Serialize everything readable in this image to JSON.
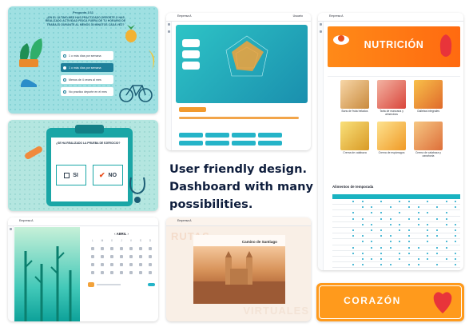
{
  "tagline": [
    "User friendly design.",
    "Dashboard with many",
    "possibilities."
  ],
  "quiz": {
    "number": "Pregunta 1/11",
    "question": "¿En el último mes has practicado deporte o has realizado actividad física fuera de tu horario de trabajo durante al menos 30 minutos cada vez?",
    "options": [
      "1 o más días por semana",
      "1 o más días por semana",
      "Menos de 4 veces al mes",
      "No practico deporte en el mes"
    ]
  },
  "clipboard": {
    "question": "¿Se ha realizado la prueba de ejercicio?",
    "yes": "SI",
    "no": "NO"
  },
  "calendar": {
    "month": "ABRIL",
    "weekdays": [
      "L",
      "M",
      "X",
      "J",
      "V",
      "S",
      "D"
    ]
  },
  "dashboard": {
    "title": "Empresa A",
    "user": "Usuario"
  },
  "nutrition": {
    "title": "NUTRICIÓN",
    "dishes": [
      "Buns de fruta helados",
      "Tarta de manzana y almendras",
      "Galletas integrales",
      "Crema de calabaza",
      "Crema de espárragos",
      "Crema de calabaza y zanahoria"
    ],
    "table_title": "Alimentos de temporada"
  },
  "camino": {
    "title": "Camino de Santiago",
    "left_word": "RUTAS",
    "right_word": "VIRTUALES"
  },
  "corazon": {
    "title": "CORAZÓN"
  },
  "colors": {
    "teal": "#1aa6c9",
    "orange": "#ff8a18",
    "navy": "#0f1e3d"
  }
}
